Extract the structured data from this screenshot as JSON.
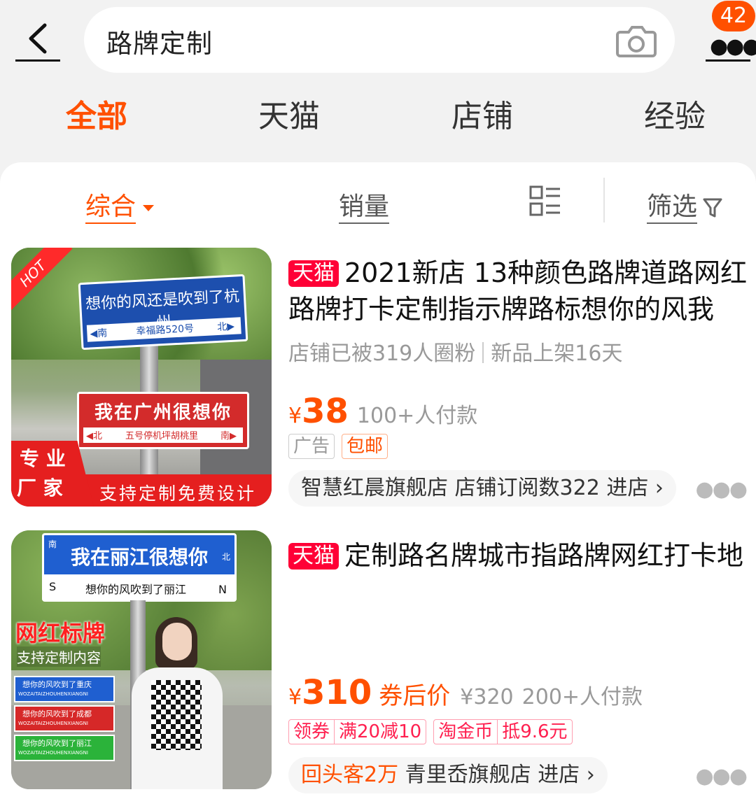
{
  "search": {
    "query": "路牌定制"
  },
  "badge": {
    "count": "42"
  },
  "tabs": [
    "全部",
    "天猫",
    "店铺",
    "经验"
  ],
  "sort": {
    "comprehensive": "综合",
    "sales": "销量",
    "filter": "筛选"
  },
  "colors": {
    "accent": "#ff5000",
    "tmall": "#ff0036"
  },
  "products": [
    {
      "tag": "天猫",
      "title": "2021新店 13种颜色路牌道路网红路牌打卡定制指示牌路标想你的风我",
      "meta_1": "店铺已被319人圈粉",
      "meta_2": "新品上架16天",
      "price_yen": "¥",
      "price": "38",
      "sales": "100+人付款",
      "tag_ad": "广告",
      "tag_freeship": "包邮",
      "shop_name": "智慧红晨旗舰店",
      "shop_subs": "店铺订阅数322",
      "shop_enter": "进店",
      "image": {
        "hot": "HOT",
        "sign1_main": "想你的风还是吹到了杭州",
        "sign1_left": "◀南",
        "sign1_road": "幸福路520号",
        "sign1_right": "北▶",
        "sign2_main": "我在广州很想你",
        "sign2_left": "◀北",
        "sign2_road": "五号停机坪胡桃里",
        "sign2_right": "南▶",
        "corner_1": "专 业",
        "corner_2": "厂 家",
        "banner": "支持定制免费设计"
      }
    },
    {
      "tag": "天猫",
      "title": "定制路名牌城市指路牌网红打卡地",
      "price_yen": "¥",
      "price": "310",
      "after_coupon": "券后价",
      "orig_price": "¥320",
      "sales": "200+人付款",
      "coupon_a": "领券",
      "coupon_b": "满20减10",
      "coin_a": "淘金币",
      "coin_b": "抵9.6元",
      "shop_highlight": "回头客2万",
      "shop_name": "青里岙旗舰店",
      "shop_enter": "进店",
      "image": {
        "sign_top_left": "南",
        "sign_main": "我在丽江很想你",
        "sign_top_right": "北",
        "sign_s": "S",
        "sign_sub": "想你的风吹到了丽江",
        "sign_n": "N",
        "headline": "网红标牌",
        "subline": "支持定制内容",
        "mini1": "想你的风吹到了重庆",
        "mini2": "想你的风吹到了成都",
        "mini3": "想你的风吹到了丽江",
        "mini_sub": "WOZAITAIZHOUHENXIANGNI"
      }
    }
  ]
}
